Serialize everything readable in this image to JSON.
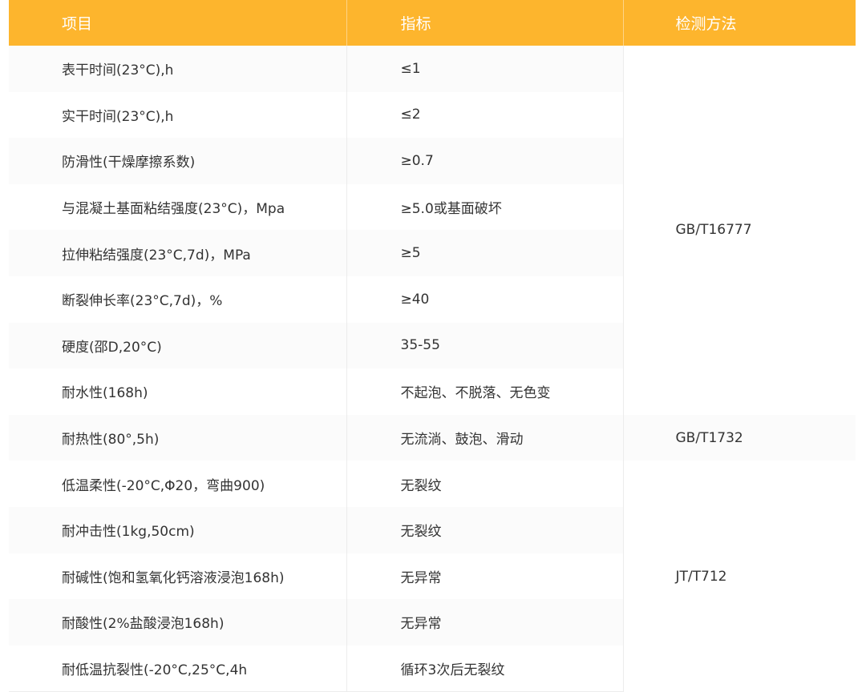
{
  "header": {
    "col_item": "项目",
    "col_spec": "指标",
    "col_method": "检测方法"
  },
  "rows": [
    {
      "item": "表干时间(23°C),h",
      "spec": "≤1"
    },
    {
      "item": "实干时间(23°C),h",
      "spec": "≤2"
    },
    {
      "item": "防滑性(干燥摩擦系数)",
      "spec": "≥0.7"
    },
    {
      "item": "与混凝土基面粘结强度(23°C)，Mpa",
      "spec": "≥5.0或基面破坏"
    },
    {
      "item": "拉伸粘结强度(23°C,7d)，MPa",
      "spec": "≥5"
    },
    {
      "item": "断裂伸长率(23°C,7d)，%",
      "spec": "≥40"
    },
    {
      "item": "硬度(邵D,20°C)",
      "spec": "35-55"
    },
    {
      "item": "耐水性(168h)",
      "spec": "不起泡、不脱落、无色变"
    },
    {
      "item": "耐热性(80°,5h)",
      "spec": "无流淌、鼓泡、滑动"
    },
    {
      "item": "低温柔性(-20°C,Φ20，弯曲900)",
      "spec": "无裂纹"
    },
    {
      "item": "耐冲击性(1kg,50cm)",
      "spec": "无裂纹"
    },
    {
      "item": "耐碱性(饱和氢氧化钙溶液浸泡168h)",
      "spec": "无异常"
    },
    {
      "item": "耐酸性(2%盐酸浸泡168h)",
      "spec": "无异常"
    },
    {
      "item": "耐低温抗裂性(-20°C,25°C,4h",
      "spec": "循环3次后无裂纹"
    }
  ],
  "methods": {
    "group1": "GB/T16777",
    "group2": "GB/T1732",
    "group3": "JT/T712"
  },
  "colors": {
    "header_bg": "#FDB52D",
    "header_text": "#ffffff",
    "stripe": "#fbfbfb"
  }
}
